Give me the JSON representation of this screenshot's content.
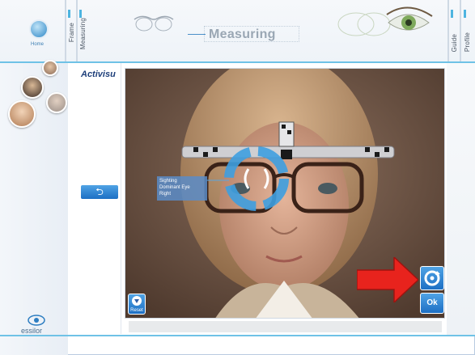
{
  "header": {
    "title": "Measuring",
    "home_label": "Home",
    "tabs_left": [
      "Frame",
      "Measuring"
    ],
    "tabs_right": [
      "Guide",
      "Profile"
    ]
  },
  "sidebar": {
    "brand": "Activisu",
    "footer_label": "essilor"
  },
  "viewport": {
    "overlay_lines": [
      "Sighting",
      "Dominant Eye",
      "Right"
    ]
  },
  "controls": {
    "back_glyph": "⮌",
    "ok_label": "Ok",
    "reset_label": "Reset"
  },
  "colors": {
    "accent": "#1d6fc4",
    "highlight_line": "#6fc2e6",
    "arrow": "#e8231d"
  }
}
